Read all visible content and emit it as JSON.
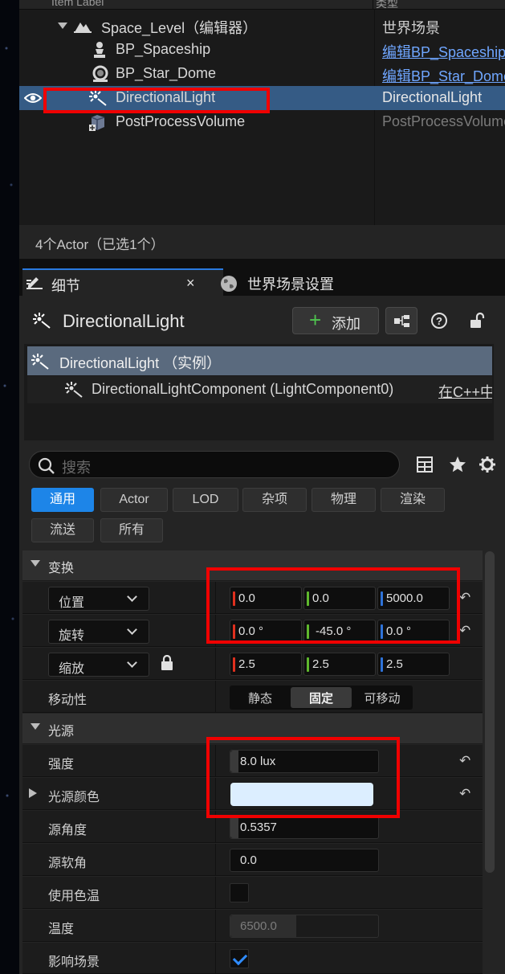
{
  "outliner": {
    "header": {
      "label_col": "Item Label",
      "type_col": "类型"
    },
    "rows": [
      {
        "label": "Space_Level（编辑器）",
        "type": "世界场景",
        "icon": "level-icon"
      },
      {
        "label": "BP_Spaceship",
        "type": "编辑BP_Spaceship",
        "icon": "pawn-icon"
      },
      {
        "label": "BP_Star_Dome",
        "type": "编辑BP_Star_Dome",
        "icon": "skydome-icon"
      },
      {
        "label": "DirectionalLight",
        "type": "DirectionalLight",
        "icon": "directional-light-icon",
        "selected": true
      },
      {
        "label": "PostProcessVolume",
        "type": "PostProcessVolume",
        "icon": "postprocess-icon"
      }
    ],
    "status": "4个Actor（已选1个）"
  },
  "tabs": {
    "details": "细节",
    "close": "×",
    "world_settings": "世界场景设置"
  },
  "actor": {
    "name": "DirectionalLight",
    "add_button": "添加"
  },
  "components": {
    "root": "DirectionalLight （实例）",
    "child": "DirectionalLightComponent (LightComponent0)",
    "child_link": "在C++中"
  },
  "search": {
    "placeholder": "搜索"
  },
  "filters": {
    "row1": [
      "通用",
      "Actor",
      "LOD",
      "杂项",
      "物理",
      "渲染"
    ],
    "row2": [
      "流送",
      "所有"
    ],
    "active": "通用"
  },
  "transform": {
    "section": "变换",
    "location": {
      "mode": "位置",
      "x": "0.0",
      "y": "0.0",
      "z": "5000.0"
    },
    "rotation": {
      "mode": "旋转",
      "x": "0.0 °",
      "y": "-45.0 °",
      "z": "0.0 °"
    },
    "scale": {
      "mode": "缩放",
      "x": "2.5",
      "y": "2.5",
      "z": "2.5"
    },
    "mobility": {
      "label": "移动性",
      "options": [
        "静态",
        "固定",
        "可移动"
      ],
      "selected": "固定"
    }
  },
  "light": {
    "section": "光源",
    "intensity": {
      "label": "强度",
      "value": "8.0 lux"
    },
    "color": {
      "label": "光源颜色",
      "value": "#dceeff"
    },
    "source_angle": {
      "label": "源角度",
      "value": "0.5357"
    },
    "source_soft_angle": {
      "label": "源软角",
      "value": "0.0"
    },
    "use_temperature": {
      "label": "使用色温",
      "checked": false
    },
    "temperature": {
      "label": "温度",
      "value": "6500.0"
    },
    "affects_world": {
      "label": "影响场景",
      "checked": true
    }
  },
  "colors": {
    "accent": "#1d85e8",
    "selection": "#355b85",
    "highlight_box": "#f00000",
    "axis_x": "#e0301e",
    "axis_y": "#5fb82d",
    "axis_z": "#2e72d8"
  }
}
